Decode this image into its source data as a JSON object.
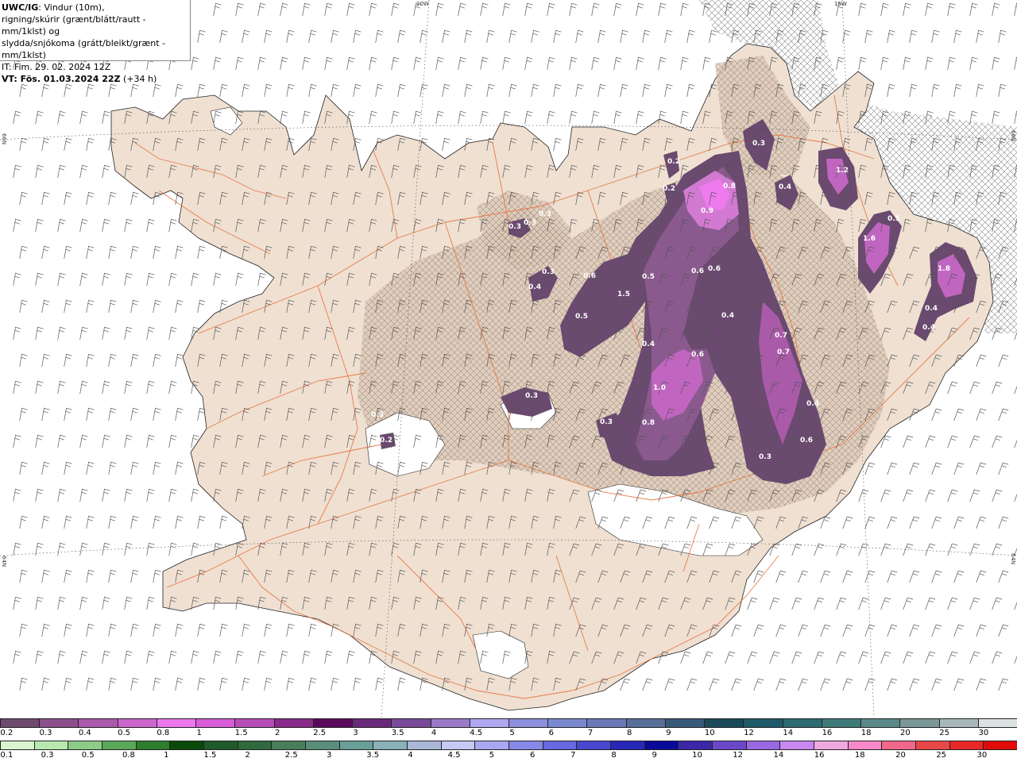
{
  "title": {
    "model": "UWC/IG",
    "line1_rest": ": Vindur (10m),",
    "line2": "rigning/skúrir (grænt/blátt/rautt - mm/1klst) og",
    "line3": "slydda/snjókoma (grátt/bleikt/grænt - mm/1klst)",
    "it": "IT: Fim. 29. 02. 2024 12Z",
    "vt_label": "VT: Fös. 01.03.2024 22Z",
    "vt_lead": " (+34 h)"
  },
  "grid_labels": {
    "top_left": "20W",
    "top_right": "15W",
    "left_upper": "66N",
    "left_lower": "64N",
    "right_upper": "66N",
    "right_lower": "64N"
  },
  "precip_labels": [
    {
      "text": "0.3"
    },
    {
      "text": "0.2"
    },
    {
      "text": "0.2"
    },
    {
      "text": "0.8"
    },
    {
      "text": "0.9"
    },
    {
      "text": "0.4"
    },
    {
      "text": "1.2"
    },
    {
      "text": "0.5"
    },
    {
      "text": "1.6"
    },
    {
      "text": "1.8"
    },
    {
      "text": "0.4"
    },
    {
      "text": "0.4"
    },
    {
      "text": "0.3"
    },
    {
      "text": "0.3"
    },
    {
      "text": "0.3"
    },
    {
      "text": "0.3"
    },
    {
      "text": "0.4"
    },
    {
      "text": "0.6"
    },
    {
      "text": "0.5"
    },
    {
      "text": "1.5"
    },
    {
      "text": "0.5"
    },
    {
      "text": "0.6"
    },
    {
      "text": "0.6"
    },
    {
      "text": "0.4"
    },
    {
      "text": "0.4"
    },
    {
      "text": "0.7"
    },
    {
      "text": "0.7"
    },
    {
      "text": "0.6"
    },
    {
      "text": "1.0"
    },
    {
      "text": "0.8"
    },
    {
      "text": "0.3"
    },
    {
      "text": "0.4"
    },
    {
      "text": "0.6"
    },
    {
      "text": "0.3"
    },
    {
      "text": "0.3"
    },
    {
      "text": "0.3"
    },
    {
      "text": "0.2"
    }
  ],
  "legend_snow": {
    "colors": [
      "#6e4a6e",
      "#8c4f8c",
      "#aa5aaa",
      "#cc66cc",
      "#ee77ee",
      "#d95cd9",
      "#b64cb6",
      "#8a2a8a",
      "#5a0a5a",
      "#6a2a7a",
      "#7a4a9a",
      "#9a7ac8",
      "#b0a8f0",
      "#8f8fe0",
      "#7a88d0",
      "#6a78b8",
      "#56709a",
      "#3a5a7a",
      "#1a4a5a",
      "#1e5a6a",
      "#2e6a72",
      "#3e7a78",
      "#5a8a88",
      "#7a9898",
      "#a8b8b8",
      "#dce2e2"
    ],
    "labels": [
      "0.2",
      "0.3",
      "0.4",
      "0.5",
      "0.8",
      "1",
      "1.5",
      "2",
      "2.5",
      "3",
      "3.5",
      "4",
      "4.5",
      "5",
      "6",
      "7",
      "8",
      "9",
      "10",
      "12",
      "14",
      "16",
      "18",
      "20",
      "25",
      "30"
    ]
  },
  "legend_rain": {
    "colors": [
      "#d8f4d0",
      "#b8e8b0",
      "#8ccc88",
      "#5aa85a",
      "#2e7e2e",
      "#0a4a0a",
      "#1e5a2a",
      "#2e6a3e",
      "#4a7e5a",
      "#5a8e7a",
      "#6aa09a",
      "#8ab0b8",
      "#aab8d8",
      "#c8c8f4",
      "#a8a8f0",
      "#8888e8",
      "#6868e0",
      "#4848d0",
      "#2828b8",
      "#0a0a9a",
      "#3a28a8",
      "#6a48c8",
      "#9a68e0",
      "#c888f0",
      "#f0a8e0",
      "#f888c8",
      "#f0688a",
      "#e84848",
      "#e82828",
      "#e00a0a"
    ],
    "labels": [
      "0.1",
      "0.3",
      "0.5",
      "0.8",
      "1",
      "1.5",
      "2",
      "2.5",
      "3",
      "3.5",
      "4",
      "4.5",
      "5",
      "6",
      "7",
      "8",
      "9",
      "10",
      "12",
      "14",
      "16",
      "18",
      "20",
      "25",
      "30"
    ]
  }
}
